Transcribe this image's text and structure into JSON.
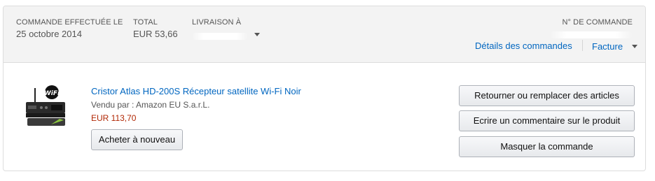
{
  "header": {
    "order_date_label": "COMMANDE EFFECTUÉE LE",
    "order_date_value": "25 octobre 2014",
    "total_label": "TOTAL",
    "total_value": "EUR 53,66",
    "delivery_label": "LIVRAISON À",
    "order_number_label": "N° DE COMMANDE",
    "order_details_link": "Détails des commandes",
    "invoice_link": "Facture"
  },
  "item": {
    "title": "Cristor Atlas HD-200S Récepteur satellite Wi-Fi Noir",
    "seller": "Vendu par : Amazon EU S.a.r.L.",
    "price": "EUR 113,70",
    "buy_again_label": "Acheter à nouveau",
    "image_badge_text": "WiFi"
  },
  "actions": {
    "return_label": "Retourner ou remplacer des articles",
    "review_label": "Ecrire un commentaire sur le produit",
    "hide_label": "Masquer la commande"
  },
  "colors": {
    "link": "#0066c0",
    "price": "#b12704",
    "header_bg": "#f3f3f3"
  }
}
